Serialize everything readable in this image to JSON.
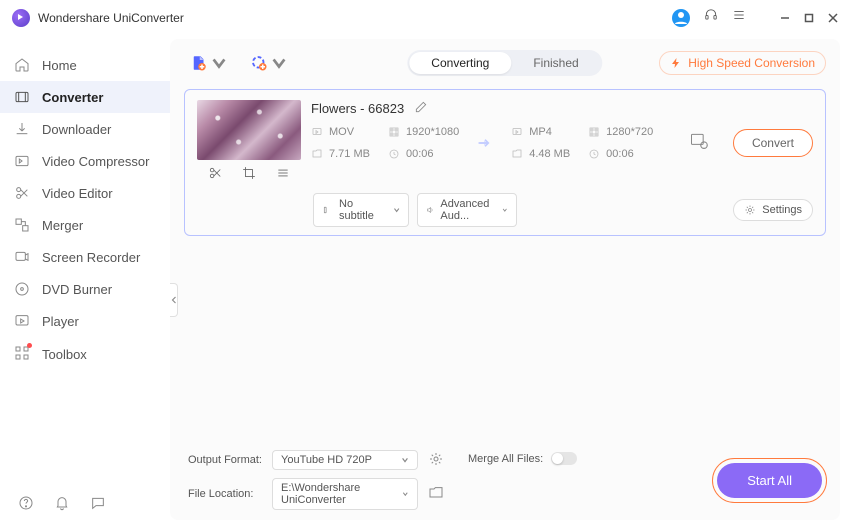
{
  "app": {
    "title": "Wondershare UniConverter"
  },
  "sidebar": {
    "items": [
      {
        "label": "Home"
      },
      {
        "label": "Converter"
      },
      {
        "label": "Downloader"
      },
      {
        "label": "Video Compressor"
      },
      {
        "label": "Video Editor"
      },
      {
        "label": "Merger"
      },
      {
        "label": "Screen Recorder"
      },
      {
        "label": "DVD Burner"
      },
      {
        "label": "Player"
      },
      {
        "label": "Toolbox"
      }
    ]
  },
  "tabs": {
    "converting": "Converting",
    "finished": "Finished"
  },
  "speed": {
    "label": "High Speed Conversion"
  },
  "file": {
    "name": "Flowers - 66823",
    "src": {
      "format": "MOV",
      "resolution": "1920*1080",
      "size": "7.71 MB",
      "duration": "00:06"
    },
    "dst": {
      "format": "MP4",
      "resolution": "1280*720",
      "size": "4.48 MB",
      "duration": "00:06"
    },
    "convert_label": "Convert",
    "subtitle": "No subtitle",
    "audio": "Advanced Aud...",
    "settings": "Settings"
  },
  "footer": {
    "output_format_label": "Output Format:",
    "output_format_value": "YouTube HD 720P",
    "file_location_label": "File Location:",
    "file_location_value": "E:\\Wondershare UniConverter",
    "merge_label": "Merge All Files:",
    "start_all": "Start All"
  }
}
